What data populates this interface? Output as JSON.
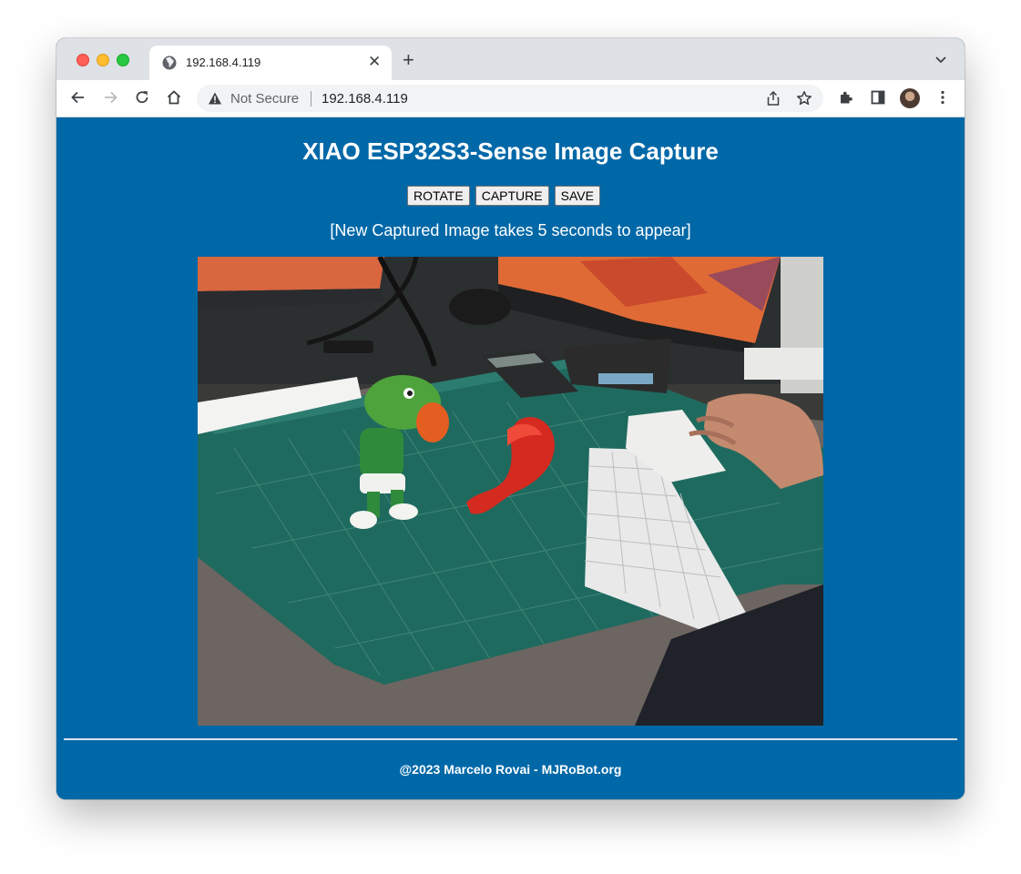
{
  "browser": {
    "tab": {
      "title": "192.168.4.119"
    },
    "address_bar": {
      "security_label": "Not Secure",
      "url": "192.168.4.119"
    }
  },
  "page": {
    "title": "XIAO ESP32S3-Sense Image Capture",
    "buttons": {
      "rotate": "ROTATE",
      "capture": "CAPTURE",
      "save": "SAVE"
    },
    "note": "[New Captured Image takes 5 seconds to appear]",
    "footer": "@2023 Marcelo Rovai - MJRoBot.org"
  },
  "colors": {
    "page_background": "#0168a8",
    "text": "#ffffff"
  }
}
